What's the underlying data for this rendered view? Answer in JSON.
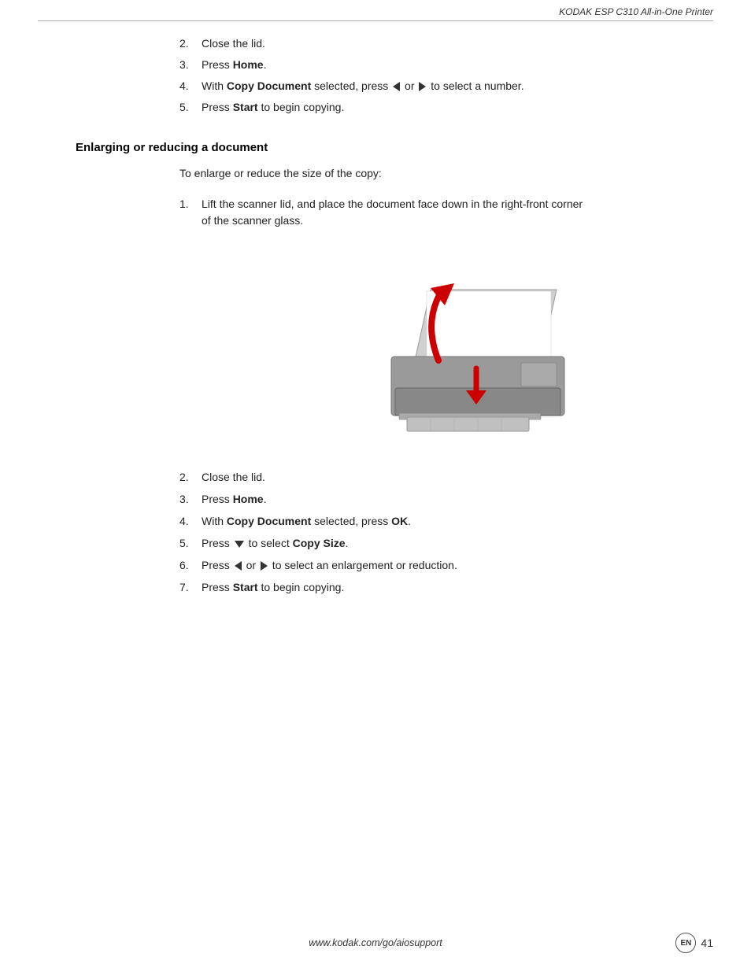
{
  "header": {
    "title": "KODAK ESP C310 All-in-One Printer"
  },
  "top_steps": [
    {
      "num": "2.",
      "text_parts": [
        {
          "text": "Close the lid.",
          "bold": false
        }
      ]
    },
    {
      "num": "3.",
      "text_parts": [
        {
          "text": "Press ",
          "bold": false
        },
        {
          "text": "Home",
          "bold": true
        },
        {
          "text": ".",
          "bold": false
        }
      ]
    },
    {
      "num": "4.",
      "text_parts": [
        {
          "text": "With ",
          "bold": false
        },
        {
          "text": "Copy Document",
          "bold": true
        },
        {
          "text": " selected, press ",
          "bold": false
        },
        {
          "text": "LEFT_ARROW",
          "bold": false,
          "type": "arrow-left"
        },
        {
          "text": " or ",
          "bold": false
        },
        {
          "text": "RIGHT_ARROW",
          "bold": false,
          "type": "arrow-right"
        },
        {
          "text": " to select a number.",
          "bold": false
        }
      ]
    },
    {
      "num": "5.",
      "text_parts": [
        {
          "text": "Press ",
          "bold": false
        },
        {
          "text": "Start",
          "bold": true
        },
        {
          "text": " to begin copying.",
          "bold": false
        }
      ]
    }
  ],
  "section_heading": "Enlarging or reducing a document",
  "intro_text": "To enlarge or reduce the size of the copy:",
  "bottom_steps": [
    {
      "num": "1.",
      "text_parts": [
        {
          "text": "Lift the scanner lid, and place the document face down in the right-front corner\nof the scanner glass.",
          "bold": false
        }
      ]
    },
    {
      "num": "2.",
      "text_parts": [
        {
          "text": "Close the lid.",
          "bold": false
        }
      ]
    },
    {
      "num": "3.",
      "text_parts": [
        {
          "text": "Press ",
          "bold": false
        },
        {
          "text": "Home",
          "bold": true
        },
        {
          "text": ".",
          "bold": false
        }
      ]
    },
    {
      "num": "4.",
      "text_parts": [
        {
          "text": "With ",
          "bold": false
        },
        {
          "text": "Copy Document",
          "bold": true
        },
        {
          "text": " selected, press ",
          "bold": false
        },
        {
          "text": "OK",
          "bold": true
        },
        {
          "text": ".",
          "bold": false
        }
      ]
    },
    {
      "num": "5.",
      "text_parts": [
        {
          "text": "Press ",
          "bold": false
        },
        {
          "text": "DOWN_ARROW",
          "type": "arrow-down"
        },
        {
          "text": " to select ",
          "bold": false
        },
        {
          "text": "Copy Size",
          "bold": true
        },
        {
          "text": ".",
          "bold": false
        }
      ]
    },
    {
      "num": "6.",
      "text_parts": [
        {
          "text": "Press ",
          "bold": false
        },
        {
          "text": "LEFT_ARROW",
          "type": "arrow-left"
        },
        {
          "text": " or ",
          "bold": false
        },
        {
          "text": "RIGHT_ARROW",
          "type": "arrow-right"
        },
        {
          "text": " to select an enlargement or reduction.",
          "bold": false
        }
      ]
    },
    {
      "num": "7.",
      "text_parts": [
        {
          "text": "Press ",
          "bold": false
        },
        {
          "text": "Start",
          "bold": true
        },
        {
          "text": " to begin copying.",
          "bold": false
        }
      ]
    }
  ],
  "footer": {
    "url": "www.kodak.com/go/aiosupport",
    "lang_badge": "EN",
    "page_number": "41"
  }
}
